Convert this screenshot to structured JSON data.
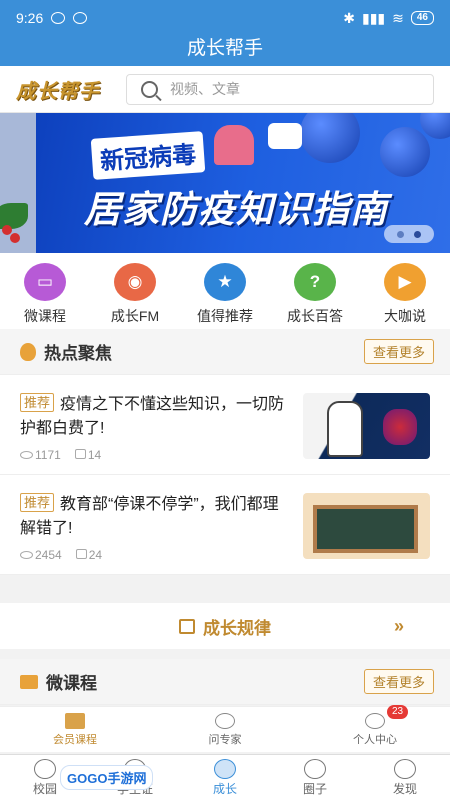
{
  "status_bar": {
    "time": "9:26",
    "battery": "46"
  },
  "app": {
    "title": "成长帮手"
  },
  "header": {
    "logo": "成长帮手",
    "search_placeholder": "视频、文章"
  },
  "banner": {
    "tag": "新冠病毒",
    "headline": "居家防疫知识指南",
    "pages": 2,
    "active_page": 1
  },
  "quick_icons": [
    {
      "label": "微课程",
      "icon": "video-card-icon",
      "color": "#b75ad6"
    },
    {
      "label": "成长FM",
      "icon": "radio-icon",
      "color": "#e86846"
    },
    {
      "label": "值得推荐",
      "icon": "star-badge-icon",
      "color": "#2f86d8"
    },
    {
      "label": "成长百答",
      "icon": "question-icon",
      "color": "#59b44a"
    },
    {
      "label": "大咖说",
      "icon": "play-icon",
      "color": "#f0a030"
    }
  ],
  "hot_focus": {
    "title": "热点聚焦",
    "more": "查看更多",
    "articles": [
      {
        "badge": "推荐",
        "title": "疫情之下不懂这些知识，一切防护都白费了!",
        "views": "1171",
        "likes": "14"
      },
      {
        "badge": "推荐",
        "title": "教育部“停课不停学”，我们都理解错了!",
        "views": "2454",
        "likes": "24"
      }
    ]
  },
  "growth_rule": {
    "label": "成长规律"
  },
  "micro_course": {
    "title": "微课程",
    "more": "查看更多"
  },
  "floating_nav": [
    {
      "label": "会员课程"
    },
    {
      "label": "问专家"
    },
    {
      "label": "个人中心",
      "badge": "23"
    }
  ],
  "tab_bar": [
    {
      "label": "校园"
    },
    {
      "label": "学生证"
    },
    {
      "label": "成长",
      "active": true
    },
    {
      "label": "圈子"
    },
    {
      "label": "发现"
    }
  ],
  "watermark": "GOGO手游网",
  "colors": {
    "primary": "#3b8fd8",
    "accent_gold": "#c08a30",
    "badge_red": "#e53935"
  }
}
